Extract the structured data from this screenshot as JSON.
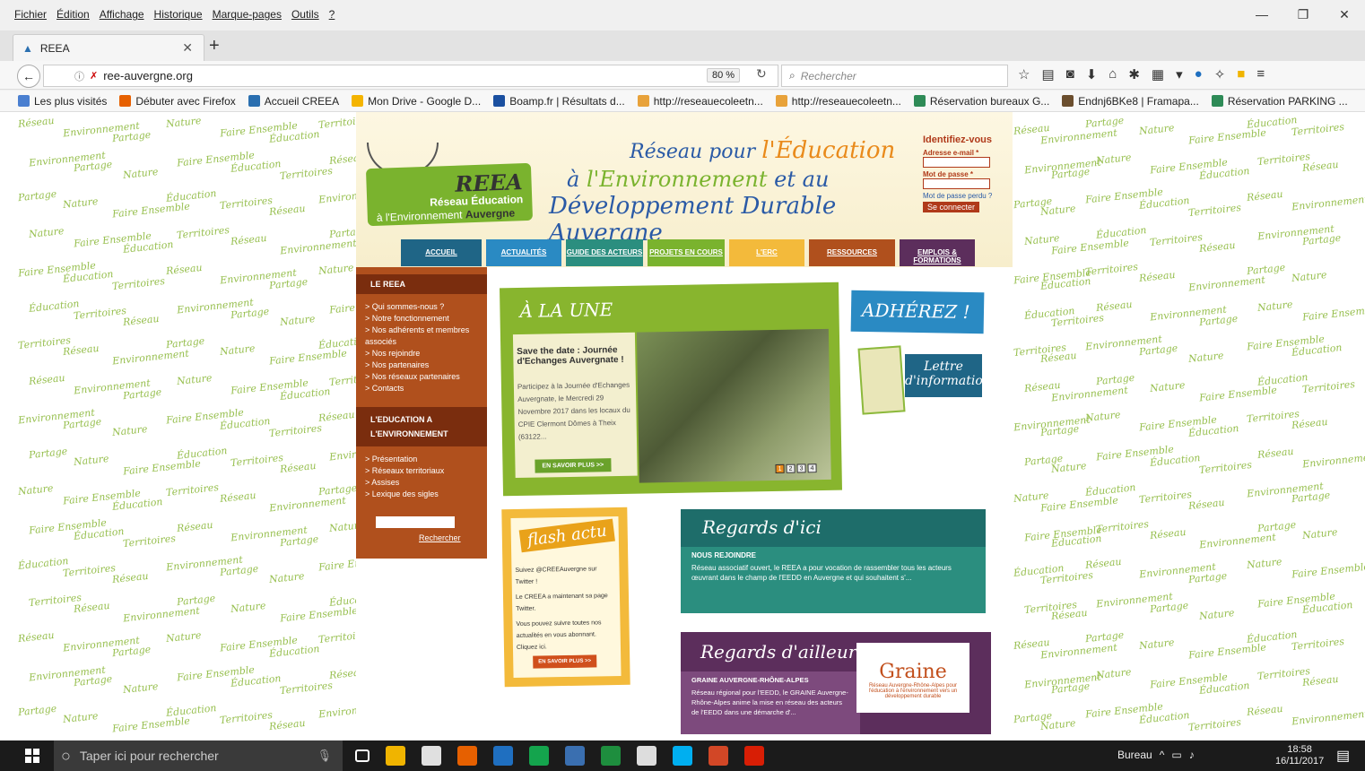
{
  "menu": [
    "Fichier",
    "Édition",
    "Affichage",
    "Historique",
    "Marque-pages",
    "Outils",
    "?"
  ],
  "window_controls": {
    "minimize": "—",
    "restore": "❐",
    "close": "✕"
  },
  "tab": {
    "title": "REEA",
    "close": "✕",
    "new_tab": "+"
  },
  "nav": {
    "url": "ree-auvergne.org",
    "zoom": "80 %",
    "search_placeholder": "Rechercher"
  },
  "bookmarks": [
    {
      "label": "Les plus visités",
      "color": "#4a7fd0"
    },
    {
      "label": "Débuter avec Firefox",
      "color": "#e66000"
    },
    {
      "label": "Accueil CREEA",
      "color": "#2a6fb0"
    },
    {
      "label": "Mon Drive - Google D...",
      "color": "#f4b400"
    },
    {
      "label": "Boamp.fr | Résultats d...",
      "color": "#1a4fa0"
    },
    {
      "label": "http://reseauecoleetn...",
      "color": "#e8a23a"
    },
    {
      "label": "http://reseauecoleetn...",
      "color": "#e8a23a"
    },
    {
      "label": "Réservation bureaux G...",
      "color": "#2e8b57"
    },
    {
      "label": "Endnj6BKe8 | Framapa...",
      "color": "#6b4e2e"
    },
    {
      "label": "Réservation PARKING ...",
      "color": "#2e8b57"
    }
  ],
  "bg_words": [
    "Réseau",
    "Environnement",
    "Partage",
    "Nature",
    "Faire Ensemble",
    "Éducation",
    "Territoires"
  ],
  "site": {
    "logo_title": "REEA",
    "logo_line1": "Réseau Éducation",
    "logo_line2a": "à l'Environnement",
    "logo_line2b": "Auvergne",
    "tag_l1a": "Réseau pour ",
    "tag_l1b": "l'Éducation",
    "tag_l2a": "à ",
    "tag_l2b": "l'Environnement",
    "tag_l2c": " et au",
    "tag_l3": "Développement Durable Auvergne",
    "login": {
      "title": "Identifiez-vous",
      "email_label": "Adresse e-mail *",
      "password_label": "Mot de passe *",
      "lost": "Mot de passe perdu ?",
      "connect": "Se connecter"
    },
    "nav": [
      {
        "label": "ACCUEIL",
        "color": "#1f6586"
      },
      {
        "label": "ACTUALITÉS",
        "color": "#2a8ac3"
      },
      {
        "label": "GUIDE DES ACTEURS",
        "color": "#2b8e7f"
      },
      {
        "label": "PROJETS EN COURS",
        "color": "#7ab32e"
      },
      {
        "label": "L'ERC",
        "color": "#f3ba3b"
      },
      {
        "label": "RESSOURCES",
        "color": "#b0501d"
      },
      {
        "label": "EMPLOIS & FORMATIONS",
        "color": "#5c2e5c"
      }
    ],
    "left": {
      "sec1": "LE REEA",
      "items1": [
        "> Qui sommes-nous ?",
        "> Notre fonctionnement",
        "> Nos adhérents et membres associés",
        "> Nos rejoindre",
        "> Nos partenaires",
        "> Nos réseaux partenaires",
        "> Contacts"
      ],
      "sec2": "L'EDUCATION A L'ENVIRONNEMENT",
      "items2": [
        "> Présentation",
        "> Réseaux territoriaux",
        "> Assises",
        "> Lexique des sigles"
      ],
      "search": "Rechercher"
    },
    "une": {
      "title": "À LA UNE",
      "headline": "Save the date : Journée d'Echanges Auvergnate !",
      "text": "Participez à la Journée d'Echanges Auvergnate, le Mercredi 29 Novembre 2017 dans les locaux du CPIE Clermont Dômes à Theix (63122...",
      "button": "EN SAVOIR PLUS >>",
      "pages": [
        "1",
        "2",
        "3",
        "4"
      ]
    },
    "adherez": "ADHÉREZ !",
    "lettre": "Lettre d'information",
    "flash": {
      "title": "flash actu",
      "p1": "Suivez @CREEAuvergne sur Twitter !",
      "p2": "Le CREEA a maintenant sa page Twitter.",
      "p3": "Vous pouvez suivre toutes nos actualités en vous abonnant. Cliquez ici.",
      "button": "EN SAVOIR PLUS >>"
    },
    "ici": {
      "title": "Regards d'ici",
      "sub": "NOUS REJOINDRE",
      "text": "Réseau associatif ouvert, le REEA a pour vocation de rassembler tous les acteurs œuvrant dans le champ de l'EEDD en Auvergne et qui souhaitent s'..."
    },
    "ailleurs": {
      "title": "Regards d'ailleurs",
      "sub": "GRAINE AUVERGNE-RHÔNE-ALPES",
      "text": "Réseau régional pour l'EEDD, le GRAINE Auvergne-Rhône-Alpes anime la mise en réseau des acteurs de l'EEDD dans une démarche d'...",
      "logo": "Graine",
      "logo_sub": "Réseau Auvergne-Rhône-Alpes pour l'éducation à l'environnement vers un développement durable"
    }
  },
  "taskbar": {
    "search": "Taper ici pour rechercher",
    "apps": [
      "#1f6fc0",
      "#f0b400",
      "#e0e0e0",
      "#e66000",
      "#1f6fc0",
      "#14a44d",
      "#3a6fb0",
      "#1e8e3e",
      "#dddddd",
      "#00aff0",
      "#d24726",
      "#d81e05"
    ],
    "tray_label": "Bureau",
    "time": "18:58",
    "date": "16/11/2017"
  }
}
